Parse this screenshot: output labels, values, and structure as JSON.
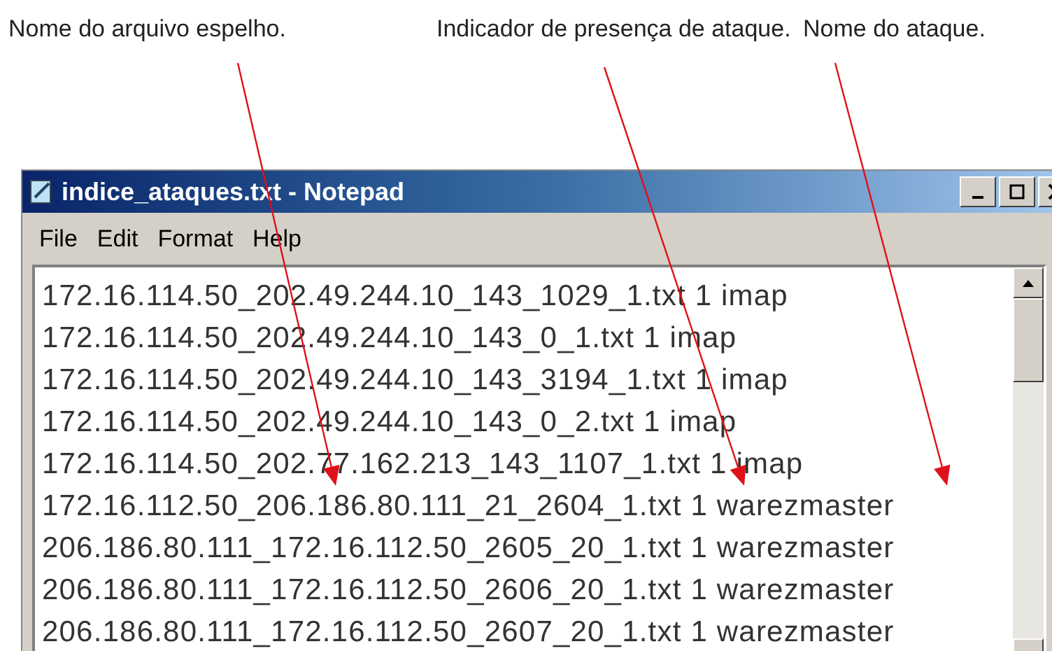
{
  "annotations": [
    {
      "text": "Nome do arquivo espelho."
    },
    {
      "text": "Indicador de presença de ataque."
    },
    {
      "text": "Nome do ataque."
    }
  ],
  "window": {
    "title": "indice_ataques.txt - Notepad"
  },
  "menu": [
    "File",
    "Edit",
    "Format",
    "Help"
  ],
  "lines": [
    "172.16.114.50_202.49.244.10_143_1029_1.txt 1 imap",
    "172.16.114.50_202.49.244.10_143_0_1.txt 1 imap",
    "172.16.114.50_202.49.244.10_143_3194_1.txt 1 imap",
    "172.16.114.50_202.49.244.10_143_0_2.txt 1 imap",
    "172.16.114.50_202.77.162.213_143_1107_1.txt 1 imap",
    "172.16.112.50_206.186.80.111_21_2604_1.txt 1 warezmaster",
    "206.186.80.111_172.16.112.50_2605_20_1.txt 1 warezmaster",
    "206.186.80.111_172.16.112.50_2606_20_1.txt 1 warezmaster",
    "206.186.80.111_172.16.112.50_2607_20_1.txt 1 warezmaster"
  ]
}
